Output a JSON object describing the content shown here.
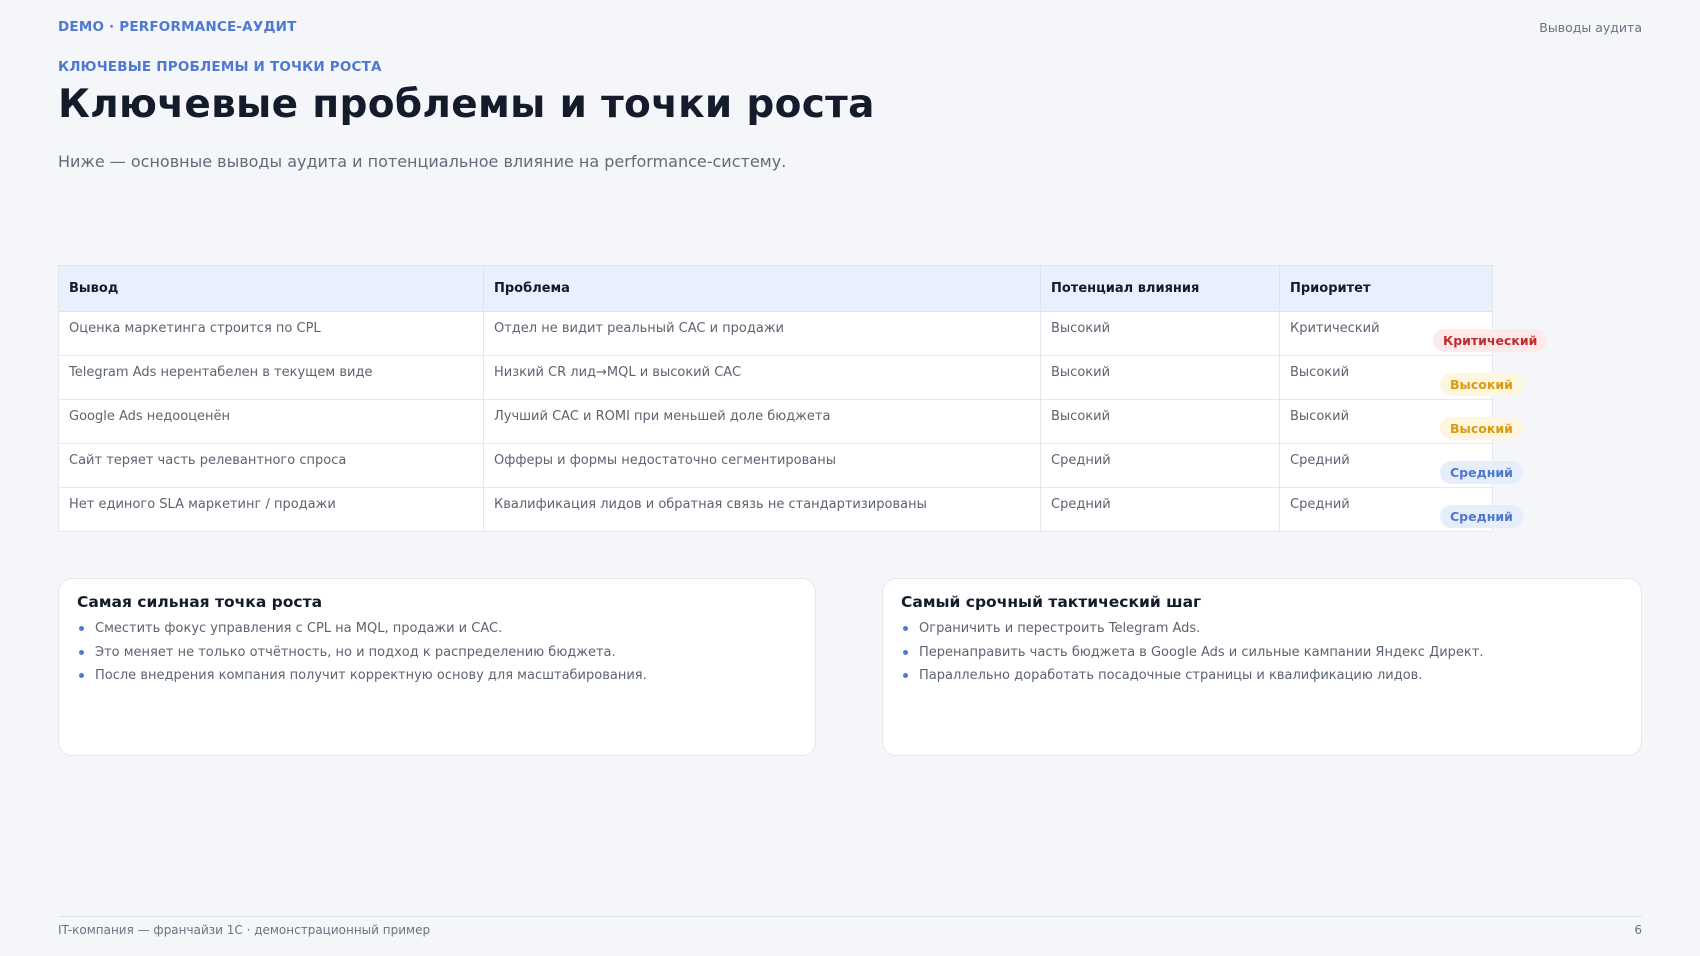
{
  "header": {
    "brand": "DEMO · PERFORMANCE-АУДИТ",
    "section": "Выводы аудита"
  },
  "eyebrow": "КЛЮЧЕВЫЕ ПРОБЛЕМЫ И ТОЧКИ РОСТА",
  "title": "Ключевые проблемы и точки роста",
  "subtitle": "Ниже — основные выводы аудита и потенциальное влияние на performance-систему.",
  "table": {
    "headers": [
      "Вывод",
      "Проблема",
      "Потенциал влияния",
      "Приоритет"
    ],
    "rows": [
      [
        "Оценка маркетинга строится по CPL",
        "Отдел не видит реальный CAC и продажи",
        "Высокий",
        "Критический",
        "Критический"
      ],
      [
        "Telegram Ads нерентабелен в текущем виде",
        "Низкий CR лид→MQL и высокий CAC",
        "Высокий",
        "Высокий",
        "Высокий"
      ],
      [
        "Google Ads недооценён",
        "Лучший CAC и ROMI при меньшей доле бюджета",
        "Высокий",
        "Высокий",
        "Высокий"
      ],
      [
        "Сайт теряет часть релевантного спроса",
        "Офферы и формы недостаточно сегментированы",
        "Средний",
        "Средний",
        "Средний"
      ],
      [
        "Нет единого SLA маркетинг / продажи",
        "Квалификация лидов и обратная связь не стандартизированы",
        "Средний",
        "Средний",
        "Средний"
      ]
    ]
  },
  "cards": {
    "left": {
      "title": "Самая сильная точка роста",
      "items": [
        "Сместить фокус управления с CPL на MQL, продажи и CAC.",
        "Это меняет не только отчётность, но и подход к распределению бюджета.",
        "После внедрения компания получит корректную основу для масштабирования."
      ]
    },
    "right": {
      "title": "Самый срочный тактический шаг",
      "items": [
        "Ограничить и перестроить Telegram Ads.",
        "Перенаправить часть бюджета в Google Ads и сильные кампании Яндекс Директ.",
        "Параллельно доработать посадочные страницы и квалификацию лидов."
      ]
    }
  },
  "footer": {
    "left": "IT-компания — франчайзи 1С · демонстрационный пример",
    "page": "6"
  },
  "colors": {
    "accent": "#4f78d0",
    "critical": "#c52a2a",
    "high": "#dc9a10",
    "medium": "#4f78d0"
  }
}
